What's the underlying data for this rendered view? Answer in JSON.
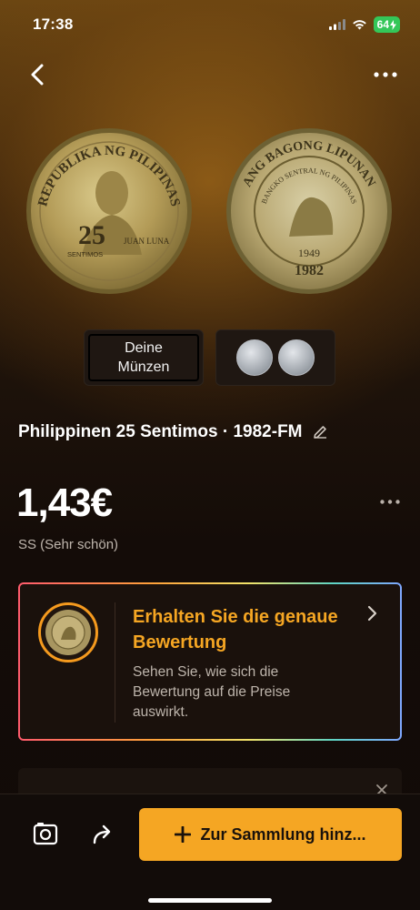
{
  "status_bar": {
    "time": "17:38",
    "battery": "64"
  },
  "nav": {
    "back_icon": "chevron-left-icon",
    "more_icon": "ellipsis-horizontal-icon"
  },
  "coin": {
    "obverse_text": "REPUBLIKA NG PILIPINAS",
    "obverse_denomination": "25",
    "obverse_unit": "SENTIMOS",
    "obverse_name": "JUAN LUNA",
    "reverse_text": "ANG BAGONG LIPUNAN",
    "reverse_bank": "BANGKO SENTRAL NG PILIPINAS",
    "reverse_est": "1949",
    "reverse_year": "1982"
  },
  "thumbs": {
    "your_coins_line1": "Deine",
    "your_coins_line2": "Münzen"
  },
  "title": "Philippinen 25 Sentimos · 1982-FM",
  "price": "1,43€",
  "grade": "SS (Sehr schön)",
  "eval_card": {
    "title": "Erhalten Sie die genaue Bewertung",
    "description": "Sehen Sie, wie sich die Bewertung auf die Preise auswirkt."
  },
  "bottom_bar": {
    "add_label": "Zur Sammlung hinz..."
  },
  "colors": {
    "accent": "#f5a623",
    "background": "#120b07",
    "text_secondary": "#bdb4ab"
  }
}
